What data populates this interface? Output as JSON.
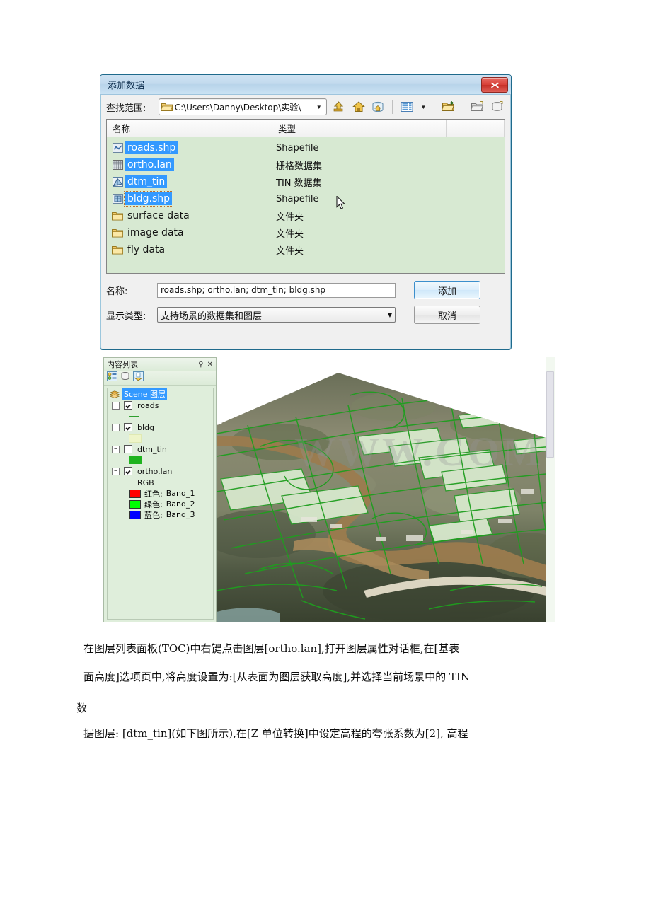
{
  "dialog": {
    "title": "添加数据",
    "close_label": "✕",
    "lookin": {
      "label": "查找范围:",
      "path": "C:\\Users\\Danny\\Desktop\\实验\\",
      "folder_icon": "folder-open-icon",
      "dropdown_icon": "chevron-down-icon"
    },
    "toolbar": [
      {
        "name": "go-up-icon",
        "title": "向上"
      },
      {
        "name": "home-icon",
        "title": "主目录"
      },
      {
        "name": "home-database-icon",
        "title": "默认地理数据库"
      },
      {
        "name": "list-view-icon",
        "title": "列表视图"
      },
      {
        "name": "view-dropdown-icon",
        "title": "视图下拉"
      },
      {
        "name": "connect-folder-icon",
        "title": "连接文件夹"
      },
      {
        "name": "new-folder-icon",
        "title": "新建文件夹"
      },
      {
        "name": "new-database-icon",
        "title": "新建数据库"
      }
    ],
    "columns": [
      "名称",
      "类型",
      ""
    ],
    "files": [
      {
        "name": "roads.shp",
        "type": "Shapefile",
        "icon": "shapefile-line-icon",
        "selected": true,
        "focused": false
      },
      {
        "name": "ortho.lan",
        "type": "栅格数据集",
        "icon": "raster-icon",
        "selected": true,
        "focused": false
      },
      {
        "name": "dtm_tin",
        "type": "TIN 数据集",
        "icon": "tin-icon",
        "selected": true,
        "focused": false
      },
      {
        "name": "bldg.shp",
        "type": "Shapefile",
        "icon": "shapefile-poly-icon",
        "selected": true,
        "focused": true
      },
      {
        "name": "surface data",
        "type": "文件夹",
        "icon": "folder-icon",
        "selected": false,
        "focused": false
      },
      {
        "name": "image data",
        "type": "文件夹",
        "icon": "folder-icon",
        "selected": false,
        "focused": false
      },
      {
        "name": "fly data",
        "type": "文件夹",
        "icon": "folder-icon",
        "selected": false,
        "focused": false
      }
    ],
    "name_field": {
      "label": "名称:",
      "value": "roads.shp; ortho.lan; dtm_tin; bldg.shp"
    },
    "type_field": {
      "label": "显示类型:",
      "value": "支持场景的数据集和图层"
    },
    "buttons": {
      "add": "添加",
      "cancel": "取消"
    }
  },
  "toc": {
    "title": "内容列表",
    "pin_icon": "pin-icon",
    "close_icon": "close-icon",
    "tabs": [
      {
        "name": "list-by-drawing-order-icon"
      },
      {
        "name": "list-by-source-icon"
      },
      {
        "name": "list-by-visibility-icon"
      }
    ],
    "root": "Scene 图层",
    "layers": [
      {
        "name": "roads",
        "checked": true,
        "symbol": "line",
        "children": []
      },
      {
        "name": "bldg",
        "checked": true,
        "symbol": "polygon",
        "children": []
      },
      {
        "name": "dtm_tin",
        "checked": false,
        "symbol": "tin",
        "children": []
      },
      {
        "name": "ortho.lan",
        "checked": true,
        "symbol": "rgb",
        "rgb_label": "RGB",
        "bands": [
          {
            "label": "红色:",
            "band": "Band_1",
            "color": "#ff0000"
          },
          {
            "label": "绿色:",
            "band": "Band_2",
            "color": "#00ff00"
          },
          {
            "label": "蓝色:",
            "band": "Band_3",
            "color": "#0000ff"
          }
        ]
      }
    ]
  },
  "scene": {
    "name": "3d-scene-view",
    "description": "ArcScene 三维场景：正射影像底图上叠加绿色道路线与浅绿色建筑面",
    "road_color": "#1f9e1f",
    "building_fill": "#d7e8cc",
    "river_color": "#9b7b4e"
  },
  "watermark": "WWW.COM",
  "doc": {
    "hang_char": "数",
    "lines": [
      "在图层列表面板(TOC)中右键点击图层[ortho.lan],打开图层属性对话框,在[基表",
      "面高度]选项页中,将高度设置为:[从表面为图层获取高度],并选择当前场景中的 TIN",
      "据图层: [dtm_tin](如下图所示),在[Z 单位转换]中设定高程的夸张系数为[2], 高程"
    ]
  }
}
